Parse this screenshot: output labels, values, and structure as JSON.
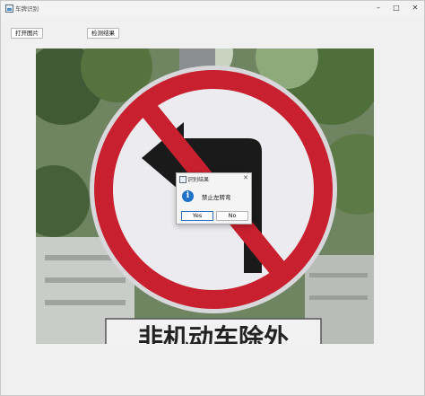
{
  "window": {
    "title": "车牌识别",
    "minimize_glyph": "–",
    "maximize_glyph": "□",
    "close_glyph": "✕"
  },
  "toolbar": {
    "open_image_label": "打开图片",
    "detect_result_label": "检测结果"
  },
  "image": {
    "subject": "no-left-turn-traffic-sign",
    "sign_text_below": "非机动车除外"
  },
  "dialog": {
    "title": "识别结果",
    "close_glyph": "✕",
    "icon": "info-icon",
    "icon_glyph": "i",
    "message": "禁止左转弯",
    "yes_label": "Yes",
    "no_label": "No"
  },
  "colors": {
    "sign_red": "#c8202e",
    "sign_white": "#ececf0",
    "arrow_black": "#1a1a1a",
    "info_blue": "#1e72c8"
  }
}
